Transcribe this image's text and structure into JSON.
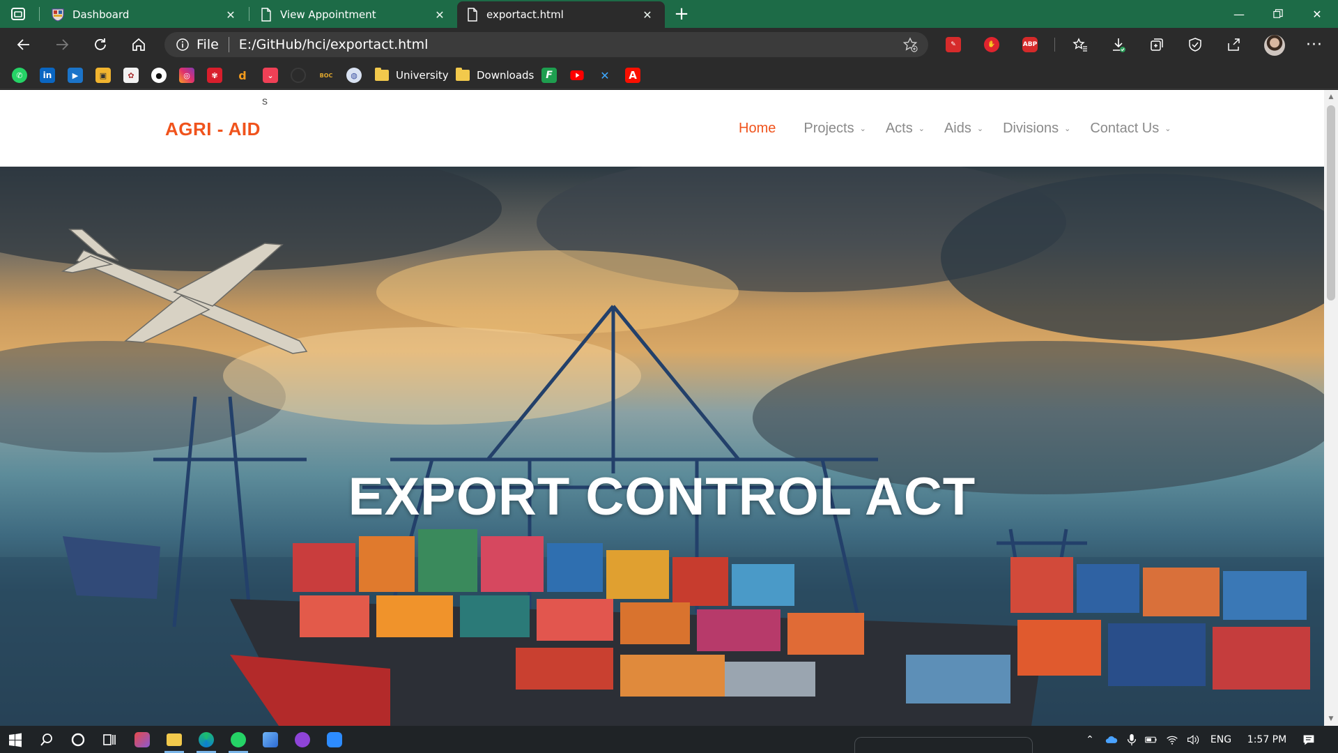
{
  "browser": {
    "tabs": [
      {
        "title": "Dashboard",
        "icon": "shield-crest-icon"
      },
      {
        "title": "View Appointment",
        "icon": "page-icon"
      },
      {
        "title": "exportact.html",
        "icon": "page-icon",
        "active": true
      }
    ],
    "address": {
      "scheme_label": "File",
      "url": "E:/GitHub/hci/exportact.html"
    },
    "extensions": [
      "cherry-tool-icon",
      "hand-stop-icon",
      "adblock-plus-icon"
    ],
    "extension_labels": {
      "adblock": "ABP"
    },
    "bookmarks": {
      "icons": [
        "whatsapp-icon",
        "linkedin-icon",
        "video-icon",
        "film-icon",
        "image-site-icon",
        "github-icon",
        "instagram-icon",
        "huawei-icon",
        "drive-icon",
        "pocket-icon",
        "dark-circle-icon",
        "boc-icon",
        "globe-icon"
      ],
      "boc_label": "BOC",
      "folders": [
        "University",
        "Downloads"
      ],
      "trailing_icons": [
        "f-logo-icon",
        "youtube-icon",
        "cross-x-icon",
        "adobe-icon"
      ]
    }
  },
  "site": {
    "stray_text": "s",
    "logo": "AGRI - AID",
    "nav": [
      {
        "label": "Home",
        "active": true,
        "dropdown": false
      },
      {
        "label": "Projects",
        "dropdown": true
      },
      {
        "label": "Acts",
        "dropdown": true
      },
      {
        "label": "Aids",
        "dropdown": true
      },
      {
        "label": "Divisions",
        "dropdown": true
      },
      {
        "label": "Contact Us",
        "dropdown": true
      }
    ],
    "hero_title": "EXPORT CONTROL ACT",
    "accent_color": "#f0531c",
    "nav_color": "#8a8a8a"
  },
  "taskbar": {
    "pinned": [
      "windows-start-icon",
      "search-icon",
      "cortana-icon",
      "task-view-icon",
      "app-red-icon",
      "file-explorer-icon",
      "edge-icon",
      "whatsapp-icon",
      "app-box-icon",
      "github-desktop-icon",
      "zoom-icon"
    ],
    "tray": {
      "language": "ENG",
      "time": "1:57 PM"
    }
  },
  "colors": {
    "tab_strip": "#1d6b47",
    "toolbar": "#2b2b2b",
    "taskbar": "#1f2326"
  }
}
